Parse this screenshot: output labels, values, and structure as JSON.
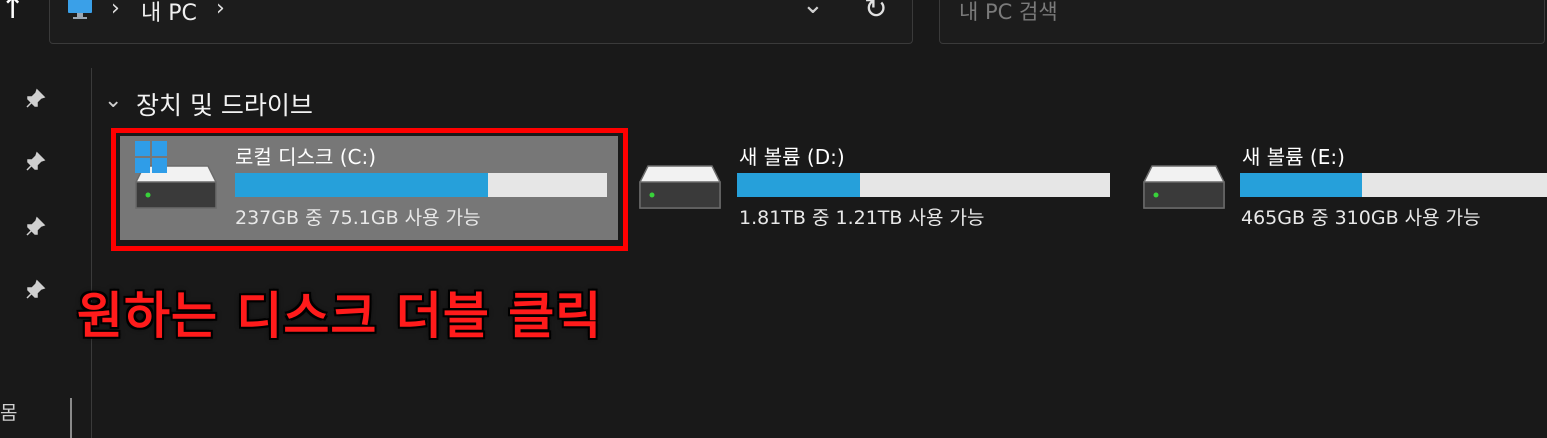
{
  "toolbar": {
    "up_glyph": "↑",
    "breadcrumb_sep": "›",
    "breadcrumb": "내 PC",
    "trailing_sep": "›",
    "dropdown_glyph": "⌄",
    "refresh_glyph": "↻"
  },
  "search": {
    "placeholder": "내 PC 검색"
  },
  "nav": {
    "pinned_count": 4,
    "bottom_label": "몸"
  },
  "section": {
    "chevron": "⌄",
    "title": "장치 및 드라이브"
  },
  "drives": [
    {
      "name": "로컬 디스크 (C:)",
      "free_text": "237GB 중 75.1GB 사용 가능",
      "used_fraction": 0.68,
      "selected": true,
      "has_windows_logo": true
    },
    {
      "name": "새 볼륨 (D:)",
      "free_text": "1.81TB 중 1.21TB 사용 가능",
      "used_fraction": 0.33,
      "selected": false,
      "has_windows_logo": false
    },
    {
      "name": "새 볼륨 (E:)",
      "free_text": "465GB 중 310GB 사용 가능",
      "used_fraction": 0.33,
      "selected": false,
      "has_windows_logo": false
    }
  ],
  "annotation": {
    "callout": "원하는 디스크 더블 클릭",
    "color": "#ff0000"
  },
  "colors": {
    "background": "#191919",
    "bar_fill": "#26a0da",
    "bar_track": "#e6e6e6",
    "selected_tile": "#777777"
  }
}
